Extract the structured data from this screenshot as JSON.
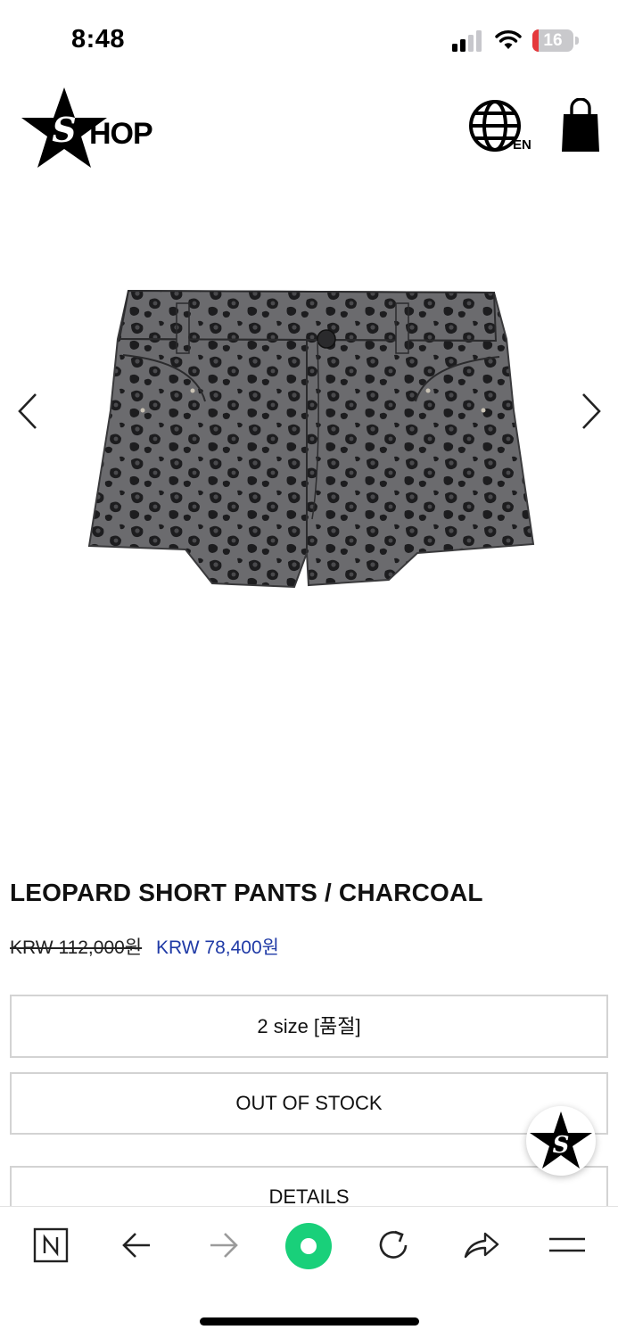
{
  "status_bar": {
    "time": "8:48",
    "battery": "16",
    "battery_level": 0.16
  },
  "header": {
    "logo_text": "HOP",
    "logo_letter": "S",
    "lang_label": "EN"
  },
  "product": {
    "title": "LEOPARD SHORT PANTS / CHARCOAL",
    "price_original": "KRW 112,000원",
    "price_sale": "KRW 78,400원"
  },
  "options": {
    "size_select": "2 size [품절]",
    "stock_button": "OUT OF STOCK",
    "details_button": "DETAILS"
  },
  "colors": {
    "sale_price": "#1f3aa6",
    "browser_accent": "#19d07a",
    "battery_low": "#e5383b"
  },
  "browser_bar": {
    "icons": [
      "naver-n-icon",
      "back-arrow-icon",
      "forward-arrow-icon",
      "green-dot-icon",
      "reload-icon",
      "share-icon",
      "menu-icon"
    ]
  }
}
